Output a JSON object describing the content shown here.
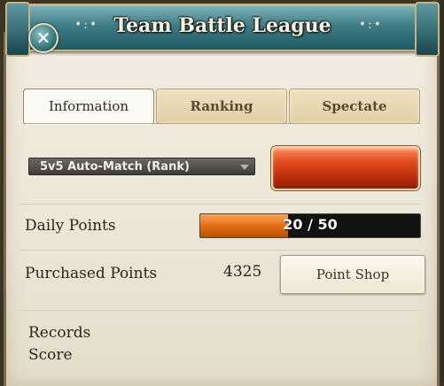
{
  "window": {
    "title": "Team Battle League",
    "title_decor_left": "•:•",
    "title_decor_right": "•:•",
    "close_symbol": "✕"
  },
  "tabs": [
    {
      "label": "Information",
      "active": true
    },
    {
      "label": "Ranking",
      "active": false
    },
    {
      "label": "Spectate",
      "active": false
    }
  ],
  "match": {
    "mode_selected": "5v5 Auto-Match (Rank)"
  },
  "daily_points": {
    "label": "Daily Points",
    "current": 20,
    "max": 50,
    "text": "20 / 50"
  },
  "purchased_points": {
    "label": "Purchased Points",
    "value": "4325",
    "shop_button_label": "Point Shop"
  },
  "records": {
    "records_label": "Records",
    "score_label": "Score"
  },
  "colors": {
    "title_bar": "#3f7d86",
    "start_button": "#e24a1e",
    "progress_fill": "#e36f17"
  }
}
